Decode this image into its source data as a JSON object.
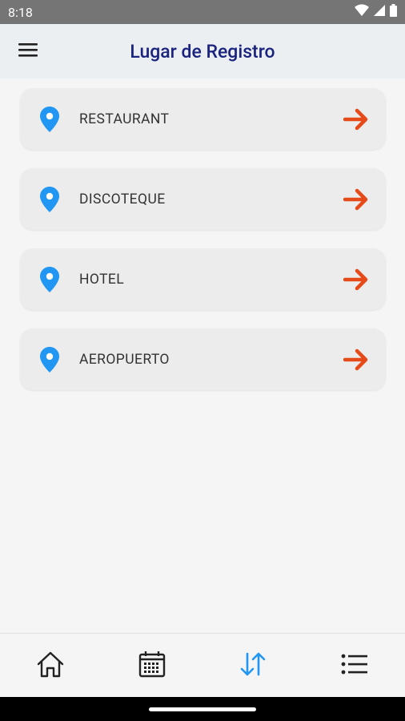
{
  "status_bar": {
    "time": "8:18"
  },
  "app_bar": {
    "title": "Lugar de Registro"
  },
  "places": [
    {
      "label": "RESTAURANT"
    },
    {
      "label": "DISCOTEQUE"
    },
    {
      "label": "HOTEL"
    },
    {
      "label": "AEROPUERTO"
    }
  ],
  "colors": {
    "accent_blue": "#2196f3",
    "arrow_orange": "#e64a19",
    "title_navy": "#1a237e"
  },
  "bottom_nav": {
    "items": [
      "home-icon",
      "calendar-icon",
      "swap-vert-icon",
      "list-icon"
    ],
    "active": "swap-vert-icon"
  }
}
